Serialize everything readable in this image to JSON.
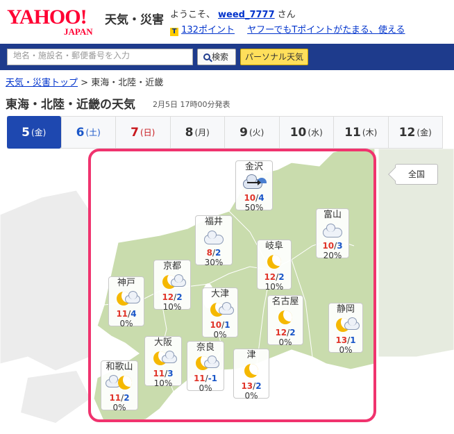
{
  "header": {
    "logo_text": "YAHOO!",
    "logo_sub": "JAPAN",
    "service_name": "天気・災害",
    "welcome_prefix": "ようこそ、",
    "username": "weed_7777",
    "welcome_suffix": "さん",
    "tpoint_icon": "T",
    "points": "132ポイント",
    "promo": "ヤフーでもTポイントがたまる、使える"
  },
  "search": {
    "placeholder": "地名・施設名・郵便番号を入力",
    "button_label": "検索",
    "personal_label": "パーソナル天気"
  },
  "breadcrumb": {
    "home": "天気・災害トップ",
    "separator": ">",
    "current": "東海・北陸・近畿"
  },
  "page": {
    "title": "東海・北陸・近畿の天気",
    "announced": "2月5日 17時00分発表"
  },
  "tabs": [
    {
      "day": "5",
      "dow": "(金)",
      "type": "weekday",
      "active": true
    },
    {
      "day": "6",
      "dow": "(土)",
      "type": "sat",
      "active": false
    },
    {
      "day": "7",
      "dow": "(日)",
      "type": "sun",
      "active": false
    },
    {
      "day": "8",
      "dow": "(月)",
      "type": "weekday",
      "active": false
    },
    {
      "day": "9",
      "dow": "(火)",
      "type": "weekday",
      "active": false
    },
    {
      "day": "10",
      "dow": "(水)",
      "type": "weekday",
      "active": false
    },
    {
      "day": "11",
      "dow": "(木)",
      "type": "weekday",
      "active": false
    },
    {
      "day": "12",
      "dow": "(金)",
      "type": "weekday",
      "active": false
    }
  ],
  "map": {
    "all_label": "全国",
    "colors": {
      "land": "#c9dcad",
      "sea": "#ffffff",
      "outside_land": "#ececec",
      "highlight": "#f0336e"
    },
    "cities": [
      {
        "name": "金沢",
        "icon": "rain-cloud-icon",
        "high": "10",
        "low": "4",
        "pop": "50%"
      },
      {
        "name": "福井",
        "icon": "cloud-icon",
        "high": "8",
        "low": "2",
        "pop": "30%"
      },
      {
        "name": "富山",
        "icon": "cloud-icon",
        "high": "10",
        "low": "3",
        "pop": "20%"
      },
      {
        "name": "岐阜",
        "icon": "moon-icon",
        "high": "12",
        "low": "2",
        "pop": "10%"
      },
      {
        "name": "京都",
        "icon": "moon-cloud-icon",
        "high": "12",
        "low": "2",
        "pop": "10%"
      },
      {
        "name": "神戸",
        "icon": "moon-cloud-icon",
        "high": "11",
        "low": "4",
        "pop": "0%"
      },
      {
        "name": "大津",
        "icon": "moon-cloud-icon",
        "high": "10",
        "low": "1",
        "pop": "0%"
      },
      {
        "name": "名古屋",
        "icon": "moon-icon",
        "high": "12",
        "low": "2",
        "pop": "0%"
      },
      {
        "name": "静岡",
        "icon": "moon-cloud-icon",
        "high": "13",
        "low": "1",
        "pop": "0%"
      },
      {
        "name": "大阪",
        "icon": "moon-cloud-icon",
        "high": "11",
        "low": "3",
        "pop": "10%"
      },
      {
        "name": "奈良",
        "icon": "moon-cloud-icon",
        "high": "11",
        "low": "-1",
        "pop": "0%"
      },
      {
        "name": "津",
        "icon": "moon-icon",
        "high": "13",
        "low": "2",
        "pop": "0%"
      },
      {
        "name": "和歌山",
        "icon": "cloud-moon-icon",
        "high": "11",
        "low": "2",
        "pop": "0%"
      }
    ]
  }
}
